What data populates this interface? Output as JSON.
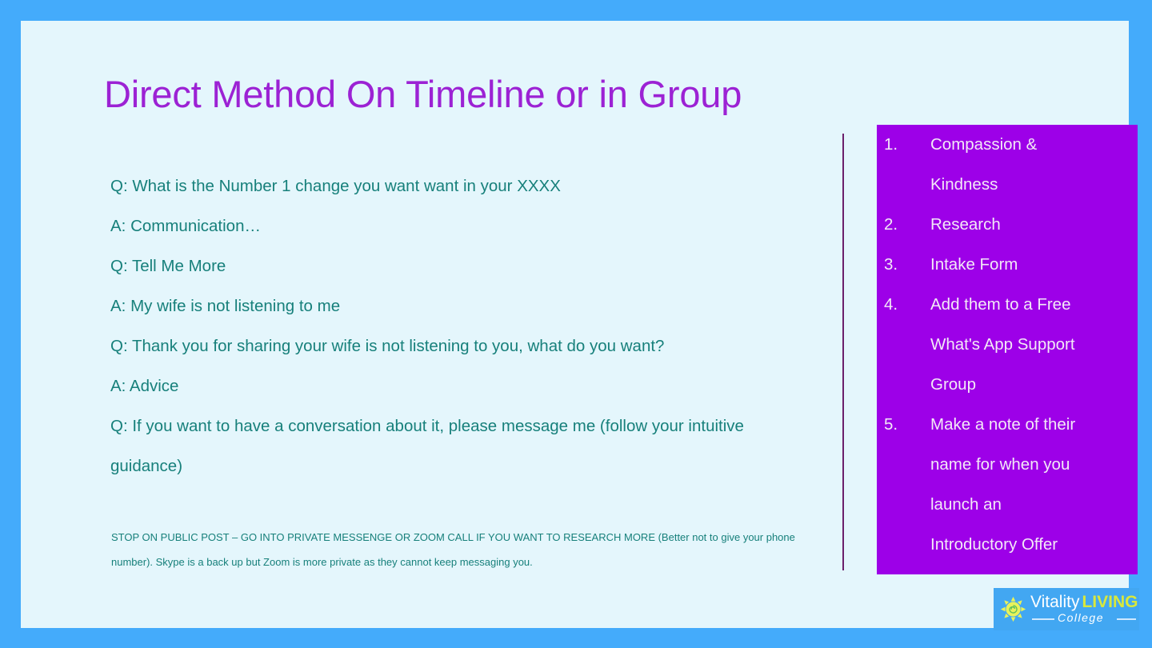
{
  "slide": {
    "title": "Direct Method On Timeline or in Group",
    "title_color": "#9c22d4",
    "background_color": "#e4f6fc",
    "frame_color": "#44abfb",
    "body_text_color": "#17807b"
  },
  "dialogue": {
    "lines": [
      "Q: What is the Number 1 change you want want in your XXXX",
      "A: Communication…",
      "Q: Tell Me More",
      "A: My wife is not listening to me",
      "Q: Thank you for sharing your wife is not listening to you, what do you want?",
      "A: Advice",
      "Q: If you want to have a conversation about it, please message me (follow your intuitive guidance)"
    ]
  },
  "footnote": {
    "text": "STOP ON PUBLIC POST – GO INTO PRIVATE MESSENGE OR ZOOM CALL IF YOU WANT TO RESEARCH MORE (Better not to give your phone number). Skype is a back up but Zoom is more private as they cannot keep messaging you."
  },
  "list_panel": {
    "background_color": "#9d00e8",
    "text_color": "#f3e9f7",
    "rows": [
      {
        "number": "1.",
        "text": "Compassion &"
      },
      {
        "number": "",
        "text": "Kindness"
      },
      {
        "number": "2.",
        "text": "Research"
      },
      {
        "number": "3.",
        "text": "Intake Form"
      },
      {
        "number": "4.",
        "text": "Add them to a  Free"
      },
      {
        "number": "",
        "text": "What's App Support"
      },
      {
        "number": "",
        "text": "Group"
      },
      {
        "number": "5.",
        "text": "Make a note of their"
      },
      {
        "number": "",
        "text": "name for when you"
      },
      {
        "number": "",
        "text": "launch an"
      },
      {
        "number": "",
        "text": "Introductory Offer"
      }
    ]
  },
  "logo": {
    "icon": "sun-icon",
    "vitality": "Vitality",
    "living": "LIVING",
    "college": "College",
    "badge_color": "#42a7f2",
    "living_color": "#d8e83c"
  }
}
